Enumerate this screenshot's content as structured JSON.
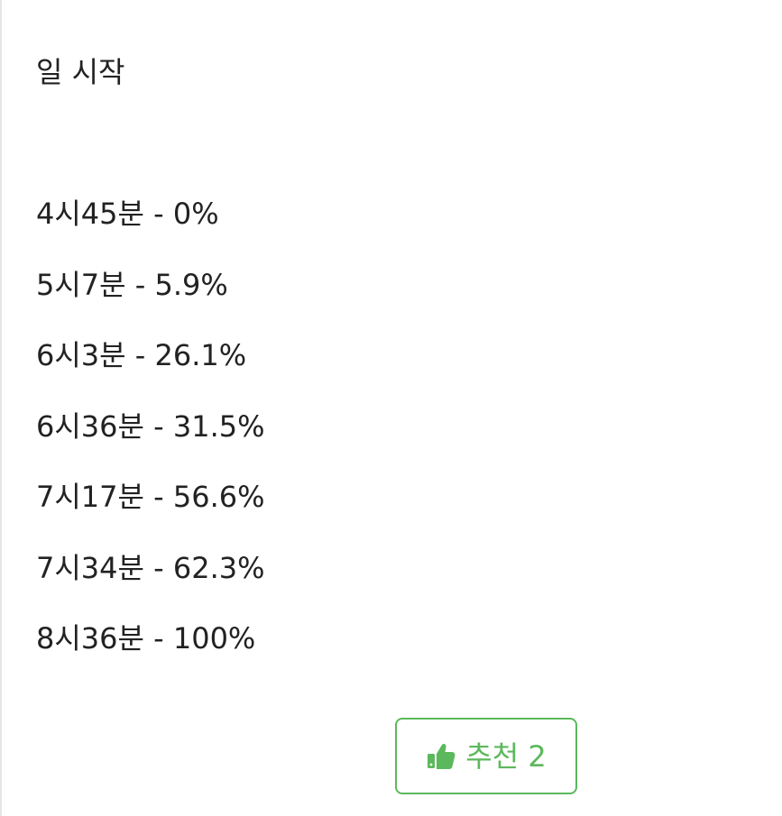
{
  "post": {
    "intro": "일 시작",
    "entries": [
      "4시45분 - 0%",
      "5시7분 - 5.9%",
      "6시3분 - 26.1%",
      "6시36분 - 31.5%",
      "7시17분 - 56.6%",
      "7시34분 - 62.3%",
      "8시36분 - 100%"
    ]
  },
  "recommend": {
    "label": "추천 2",
    "icon": "thumbs-up-icon",
    "color": "#5cb85c"
  }
}
